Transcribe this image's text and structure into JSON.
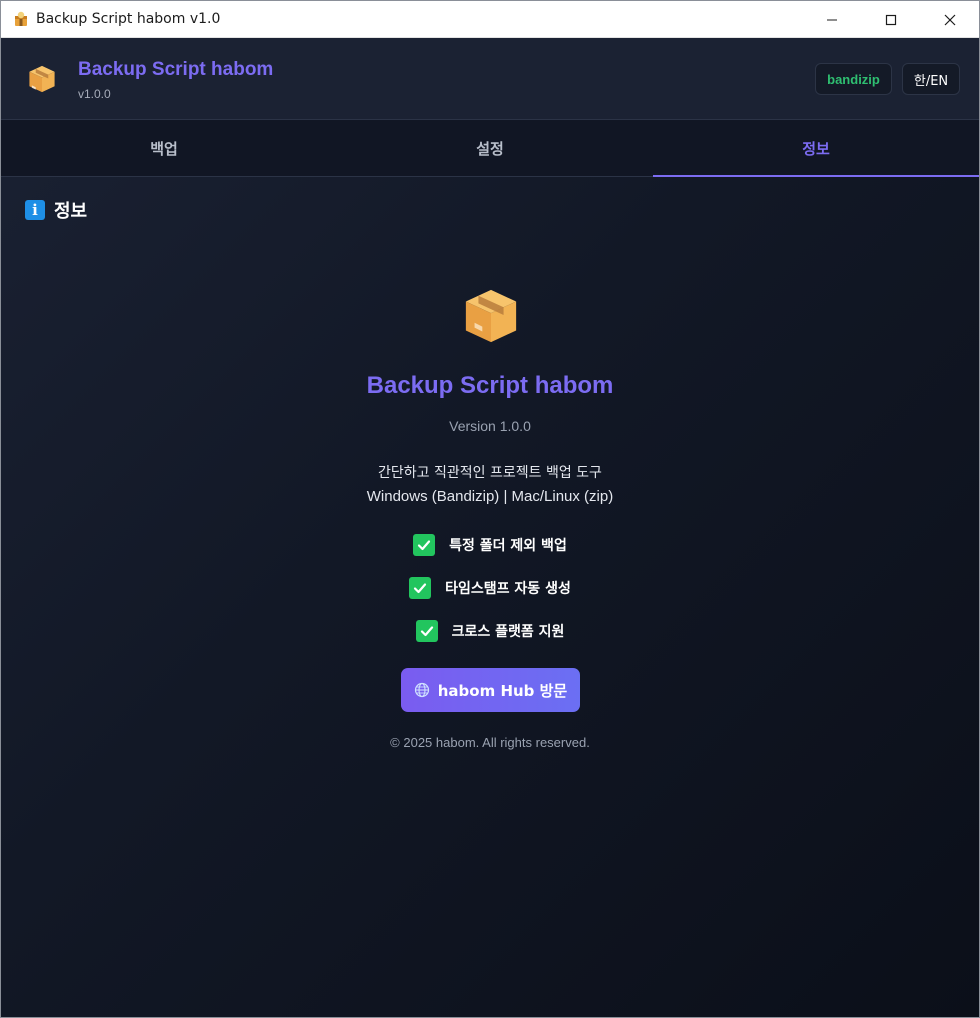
{
  "window": {
    "title": "Backup Script habom v1.0",
    "controls": [
      "minimize-icon",
      "maximize-icon",
      "close-icon"
    ]
  },
  "header": {
    "app_name": "Backup Script habom",
    "version": "v1.0.0",
    "badge_bandizip": "bandizip",
    "language_toggle": "한/EN",
    "logo_icon": "package-box-icon"
  },
  "tabs": [
    {
      "label": "백업",
      "active": false
    },
    {
      "label": "설정",
      "active": false
    },
    {
      "label": "정보",
      "active": true
    }
  ],
  "section": {
    "title": "정보",
    "icon": "info-icon"
  },
  "about": {
    "title": "Backup Script habom",
    "version": "Version 1.0.0",
    "description": "간단하고 직관적인 프로젝트 백업 도구",
    "platforms": "Windows (Bandizip) | Mac/Linux (zip)",
    "features": [
      "특정 폴더 제외 백업",
      "타임스탬프 자동 생성",
      "크로스 플랫폼 지원"
    ],
    "hub_button": "habom Hub 방문",
    "copyright": "© 2025 habom. All rights reserved."
  },
  "colors": {
    "accent": "#7c6cf2",
    "success": "#22c55e",
    "background": "#121826"
  }
}
